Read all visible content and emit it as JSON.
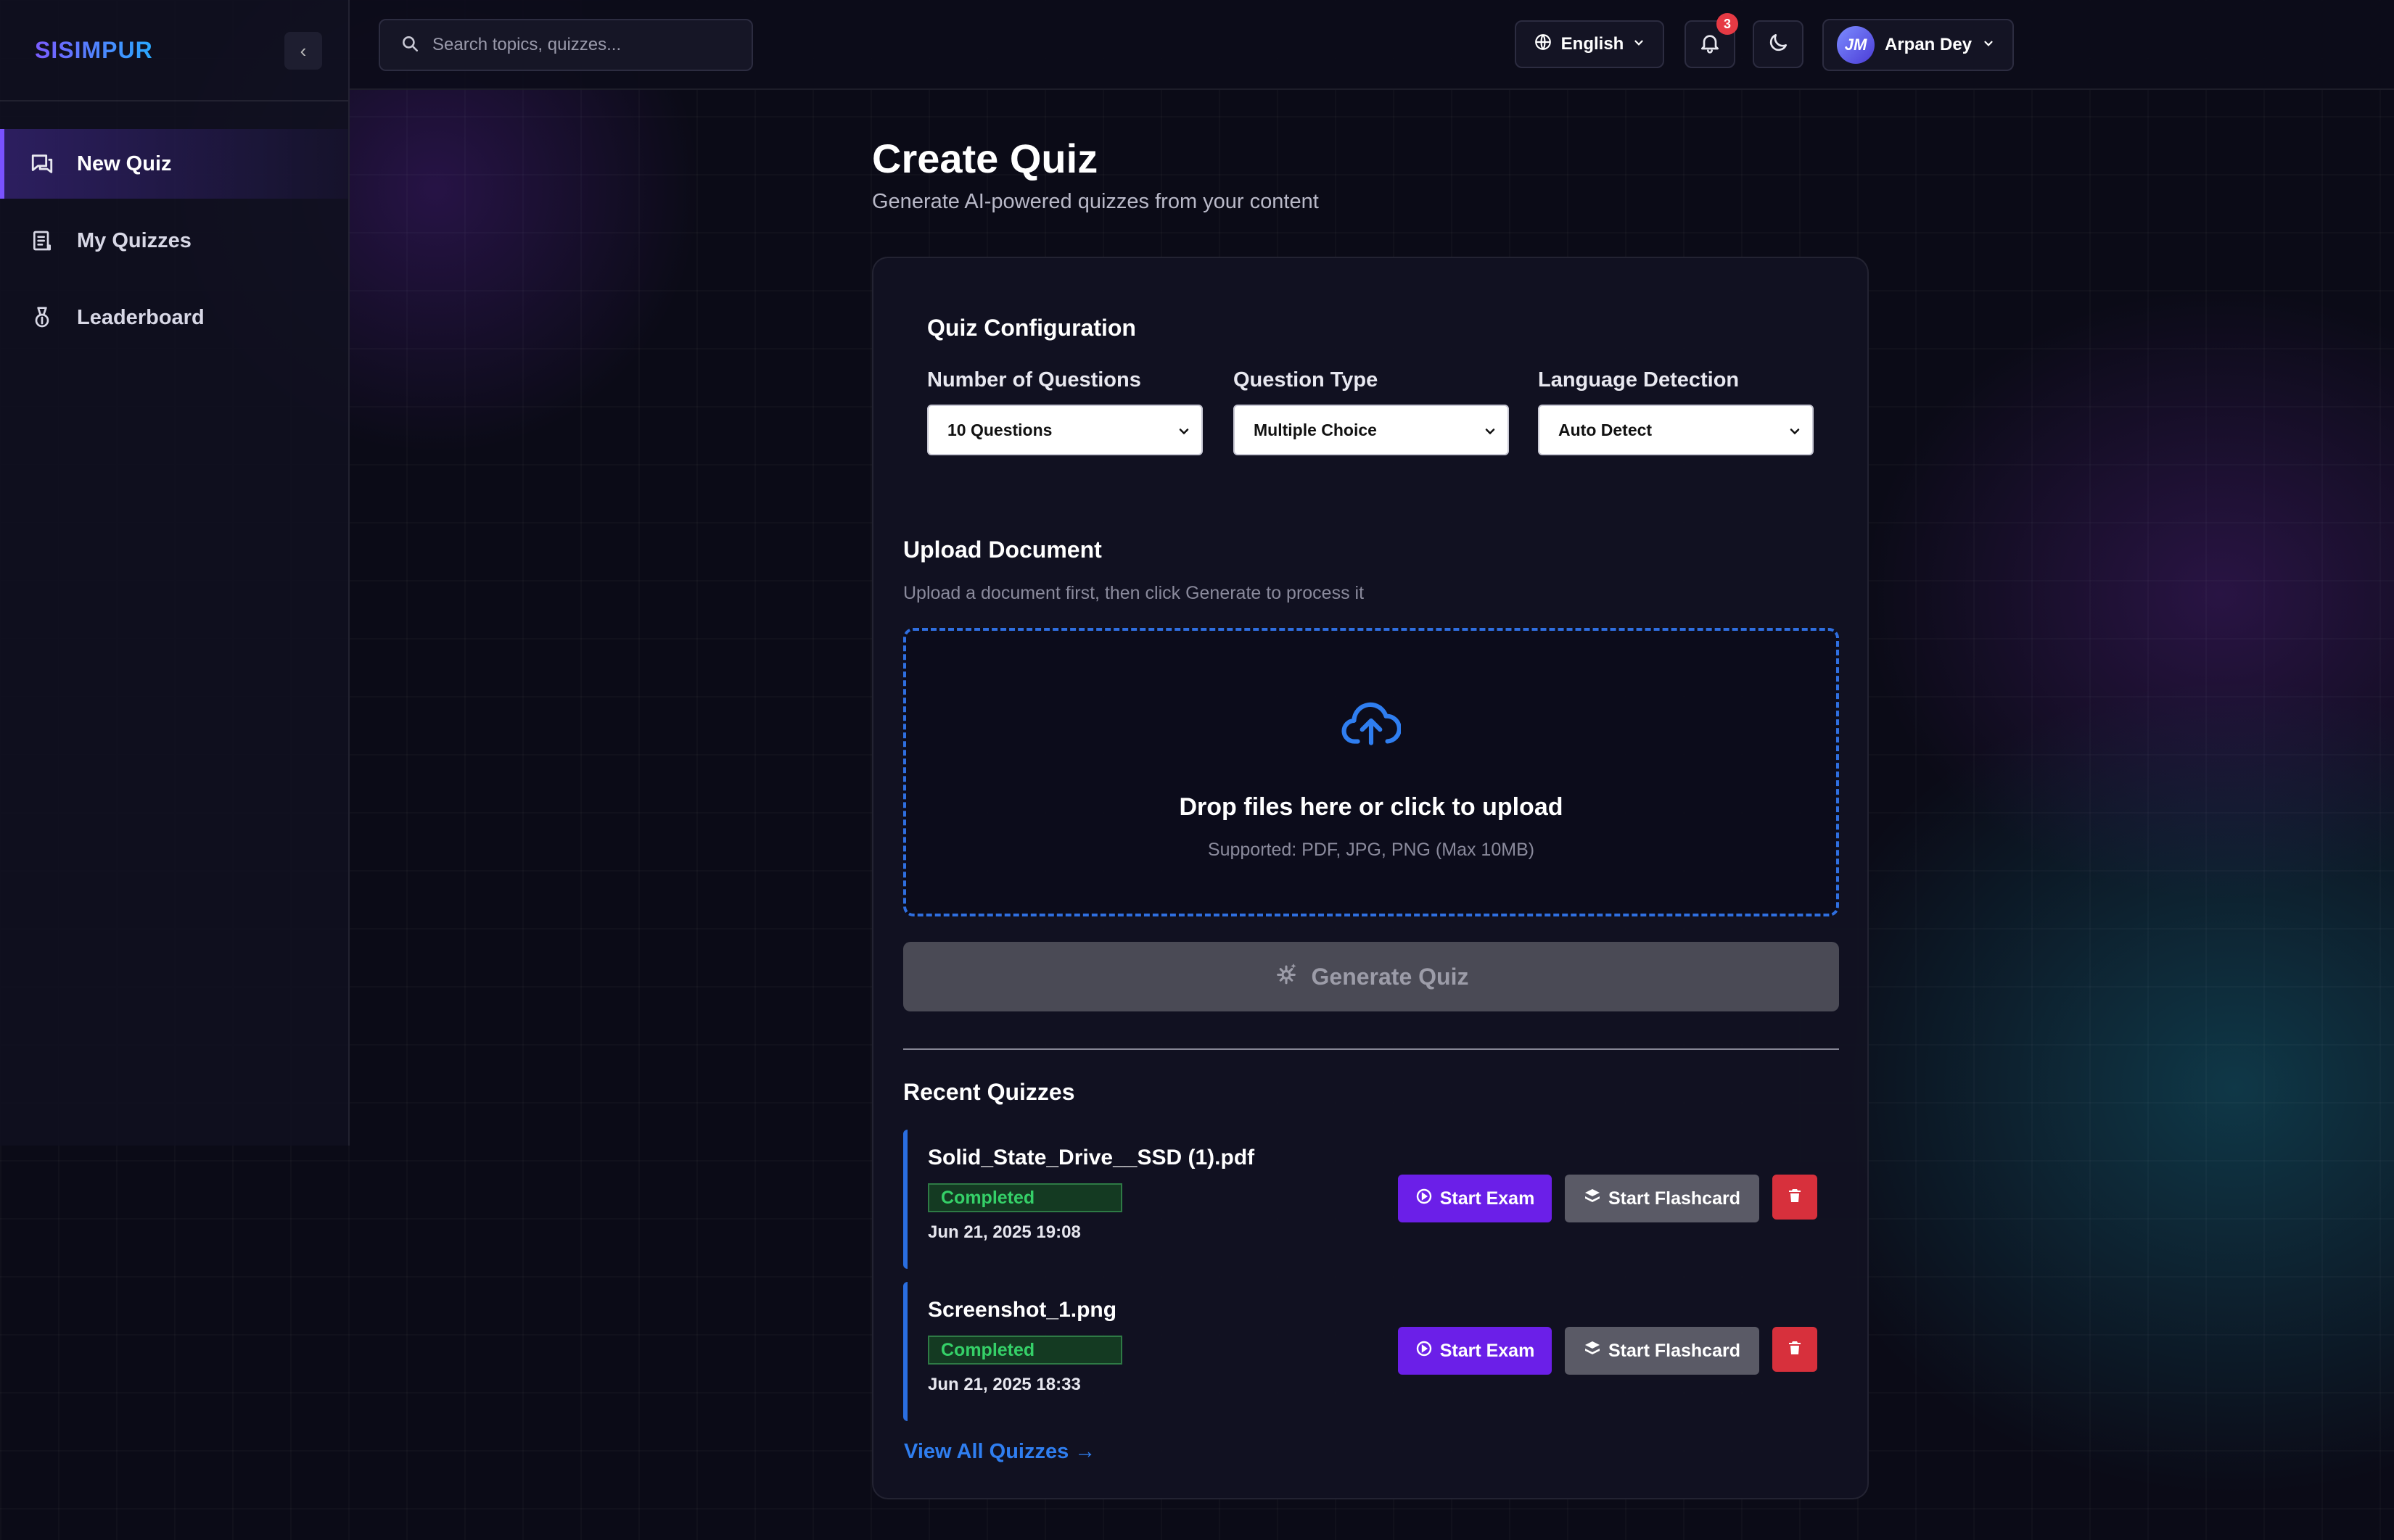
{
  "app": {
    "brand": "SISIMPUR",
    "collapse_glyph": "‹"
  },
  "sidebar": {
    "items": [
      {
        "label": "New Quiz",
        "icon": "new-quiz-icon",
        "active": true
      },
      {
        "label": "My Quizzes",
        "icon": "document-list-icon",
        "active": false
      },
      {
        "label": "Leaderboard",
        "icon": "medal-icon",
        "active": false
      }
    ]
  },
  "topbar": {
    "search_placeholder": "Search topics, quizzes...",
    "language": "English",
    "notification_count": "3",
    "user_name": "Arpan Dey",
    "avatar_initials": "JM"
  },
  "page": {
    "title": "Create Quiz",
    "subtitle": "Generate AI-powered quizzes from your content"
  },
  "config": {
    "title": "Quiz Configuration",
    "fields": [
      {
        "label": "Number of Questions",
        "value": "10 Questions"
      },
      {
        "label": "Question Type",
        "value": "Multiple Choice"
      },
      {
        "label": "Language Detection",
        "value": "Auto Detect"
      }
    ]
  },
  "upload": {
    "title": "Upload Document",
    "hint": "Upload a document first, then click Generate to process it",
    "drop_title": "Drop files here or click to upload",
    "drop_sub": "Supported: PDF, JPG, PNG (Max 10MB)",
    "generate_label": "Generate Quiz"
  },
  "recent": {
    "title": "Recent Quizzes",
    "items": [
      {
        "name": "Solid_State_Drive__SSD (1).pdf",
        "status": "Completed",
        "date": "Jun 21, 2025 19:08"
      },
      {
        "name": "Screenshot_1.png",
        "status": "Completed",
        "date": "Jun 21, 2025 18:33"
      }
    ],
    "start_exam_label": "Start Exam",
    "start_flashcard_label": "Start Flashcard",
    "view_all": "View All Quizzes →"
  },
  "colors": {
    "accent_purple": "#6b1fe8",
    "accent_blue": "#2f7ef0",
    "danger": "#d7303c",
    "success": "#35d068",
    "background": "#0b0b17"
  }
}
